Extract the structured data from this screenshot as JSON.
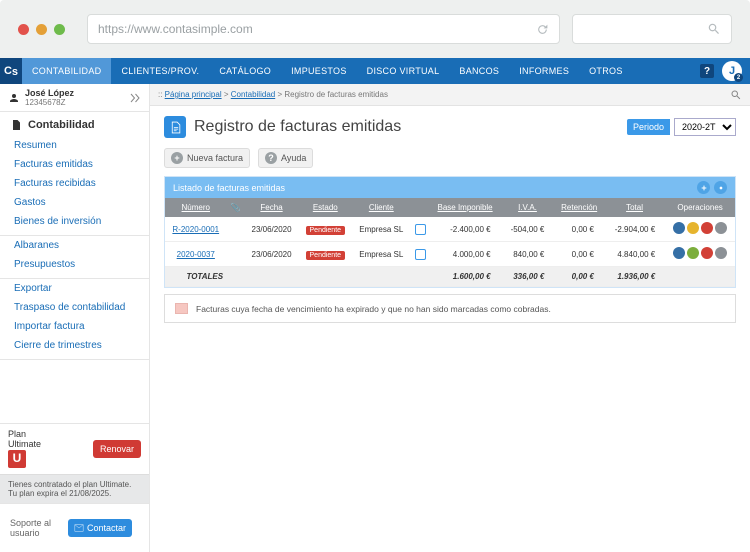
{
  "browser": {
    "url": "https://www.contasimple.com"
  },
  "topnav": {
    "brand": "Cs",
    "items": [
      "CONTABILIDAD",
      "CLIENTES/PROV.",
      "CATÁLOGO",
      "IMPUESTOS",
      "DISCO VIRTUAL",
      "BANCOS",
      "INFORMES",
      "OTROS"
    ],
    "active_index": 0,
    "notif_count": "2"
  },
  "user": {
    "name": "José López",
    "id": "12345678Z"
  },
  "sidebar": {
    "title": "Contabilidad",
    "group1": [
      "Resumen",
      "Facturas emitidas",
      "Facturas recibidas",
      "Gastos",
      "Bienes de inversión"
    ],
    "group2": [
      "Albaranes",
      "Presupuestos"
    ],
    "group3": [
      "Exportar",
      "Traspaso de contabilidad",
      "Importar factura",
      "Cierre de trimestres"
    ],
    "plan": {
      "label1": "Plan",
      "label2": "Ultimate",
      "renew": "Renovar",
      "msg": "Tienes contratado el plan Ultimate. Tu plan expira el 21/08/2025."
    },
    "support": {
      "label": "Soporte al usuario",
      "button": "Contactar"
    }
  },
  "breadcrumb": {
    "home": "Página principal",
    "sect": "Contabilidad",
    "page": "Registro de facturas emitidas"
  },
  "page": {
    "title": "Registro de facturas emitidas",
    "period_label": "Periodo",
    "period_value": "2020-2T"
  },
  "toolbar": {
    "new": "Nueva factura",
    "help": "Ayuda"
  },
  "panel_title": "Listado de facturas emitidas",
  "columns": {
    "numero": "Número",
    "fecha": "Fecha",
    "estado": "Estado",
    "cliente": "Cliente",
    "base": "Base Imponible",
    "iva": "I.V.A.",
    "retencion": "Retención",
    "total": "Total",
    "ops": "Operaciones"
  },
  "rows": [
    {
      "numero": "R-2020-0001",
      "fecha": "23/06/2020",
      "estado": "Pendiente",
      "cliente": "Empresa SL",
      "base": "-2.400,00 €",
      "iva": "-504,00 €",
      "ret": "0,00 €",
      "total": "-2.904,00 €"
    },
    {
      "numero": "2020-0037",
      "fecha": "23/06/2020",
      "estado": "Pendiente",
      "cliente": "Empresa SL",
      "base": "4.000,00 €",
      "iva": "840,00 €",
      "ret": "0,00 €",
      "total": "4.840,00 €"
    }
  ],
  "totals": {
    "label": "TOTALES",
    "base": "1.600,00 €",
    "iva": "336,00 €",
    "ret": "0,00 €",
    "total": "1.936,00 €"
  },
  "legend": "Facturas cuya fecha de vencimiento ha expirado y que no han sido marcadas como cobradas."
}
